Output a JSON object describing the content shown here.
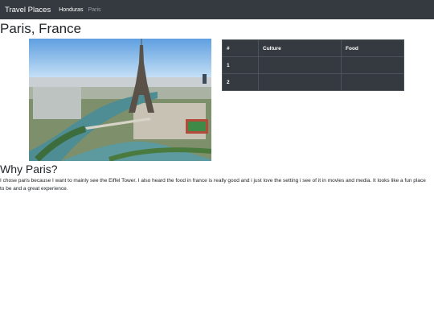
{
  "nav": {
    "brand": "Travel Places",
    "links": [
      {
        "label": "Honduras",
        "active": true
      },
      {
        "label": "Paris",
        "active": false
      }
    ]
  },
  "page": {
    "title": "Paris, France",
    "image_alt": "Eiffel Tower"
  },
  "table": {
    "headers": [
      "#",
      "Culture",
      "Food"
    ],
    "rows": [
      [
        "1",
        "",
        ""
      ],
      [
        "2",
        "",
        ""
      ]
    ]
  },
  "section": {
    "heading": "Why Paris?",
    "paragraph": "I chose paris because I want to mainly see the Eiffel Tower. I also heard the food in france is really good and i just love the setting i see of it in movies and media. It looks like a fun place to be and a great experience."
  },
  "colors": {
    "navbar_bg": "#343a40",
    "table_bg": "#343a40"
  }
}
